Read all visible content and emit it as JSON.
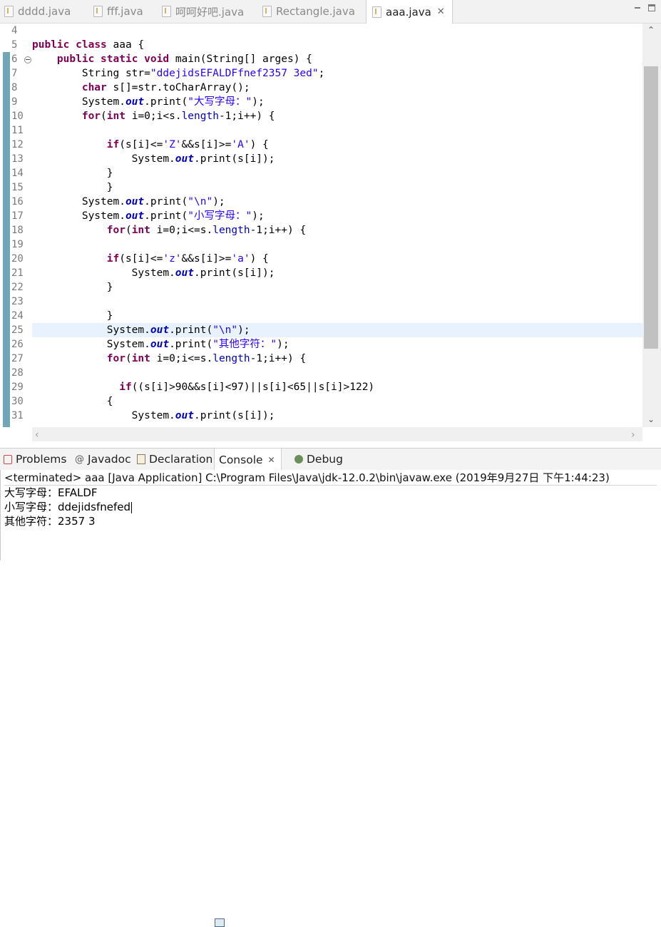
{
  "editor_tabs": [
    {
      "label": "dddd.java"
    },
    {
      "label": "fff.java"
    },
    {
      "label": "呵呵好吧.java"
    },
    {
      "label": "Rectangle.java"
    },
    {
      "label": "aaa.java",
      "active": true
    }
  ],
  "editor": {
    "line_numbers": [
      "4",
      "5",
      "6",
      "7",
      "8",
      "9",
      "10",
      "11",
      "12",
      "13",
      "14",
      "15",
      "16",
      "17",
      "18",
      "19",
      "20",
      "21",
      "22",
      "23",
      "24",
      "25",
      "26",
      "27",
      "28",
      "29",
      "30",
      "31"
    ],
    "current_line": "25",
    "code_strings": {
      "l7": "\"ddejidsEFALDFfnef2357 3ed\"",
      "l9": "\"大写字母：\"",
      "l12a": "'Z'",
      "l12b": "'A'",
      "l16": "\"\\n\"",
      "l17": "\"小写字母：\"",
      "l20a": "'z'",
      "l20b": "'a'",
      "l25": "\"\\n\"",
      "l26": "\"其他字符：\""
    }
  },
  "view_tabs": [
    {
      "label": "Problems",
      "icon": "problems-icon"
    },
    {
      "label": "Javadoc",
      "icon": "javadoc-icon"
    },
    {
      "label": "Declaration",
      "icon": "declaration-icon"
    },
    {
      "label": "Console",
      "icon": "console-icon",
      "active": true
    },
    {
      "label": "Debug",
      "icon": "debug-icon"
    }
  ],
  "console": {
    "status": "<terminated> aaa [Java Application] C:\\Program Files\\Java\\jdk-12.0.2\\bin\\javaw.exe (2019年9月27日 下午1:44:23)",
    "output": [
      "大写字母：EFALDF",
      "小写字母：ddejidsfnefed",
      "其他字符：2357 3"
    ]
  }
}
